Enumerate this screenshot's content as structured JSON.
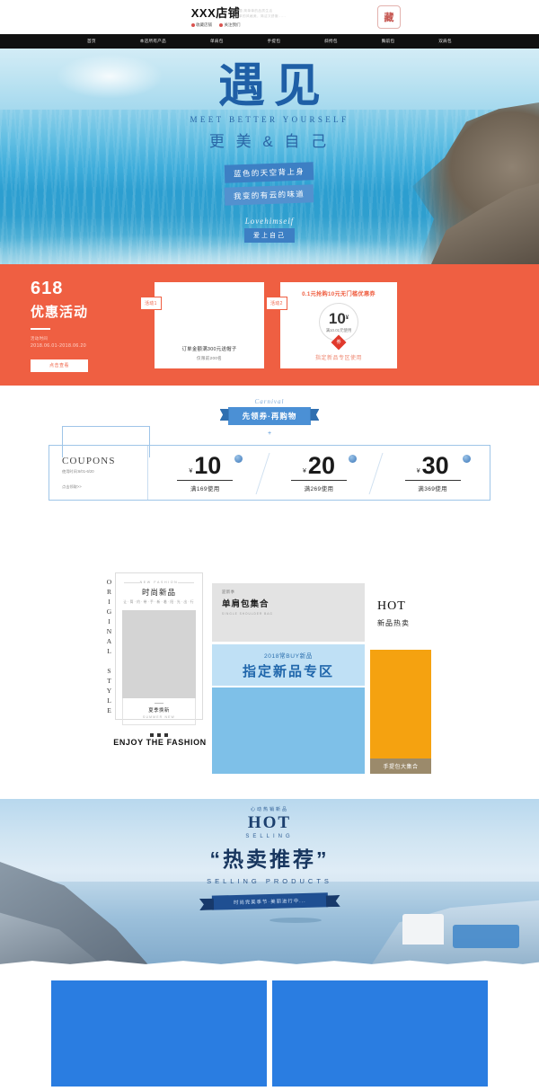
{
  "header": {
    "shop_name": "XXX店铺",
    "links": [
      {
        "label": "收藏店铺",
        "icon": "heart-icon"
      },
      {
        "label": "关注我们",
        "icon": "at-icon"
      }
    ],
    "slogan_line1": "主题  简单单的品质生活",
    "slogan_line2": "简单的风格美，简洁又舒服......",
    "seal_text": "藏"
  },
  "nav": {
    "items": [
      {
        "label": "首页"
      },
      {
        "label": "本店所有产品"
      },
      {
        "label": "单肩包"
      },
      {
        "label": "手提包"
      },
      {
        "label": "斜挎包"
      },
      {
        "label": "胸前包"
      },
      {
        "label": "双肩包"
      }
    ]
  },
  "hero": {
    "main_title": "遇见",
    "sub_en": "MEET BETTER YOURSELF",
    "sub_cn": "更 美 & 自 己",
    "tag1": "蓝色的天空背上身",
    "tag2": "我变的有云的味道",
    "script": "Lovehimself",
    "love_label": "爱上自己"
  },
  "promo618": {
    "number": "618",
    "title": "优惠活动",
    "time_label": "活动时间",
    "time_value": "2018.06.01-2018.06.20",
    "button": "点击查看",
    "card1": {
      "flag": "活动1",
      "line1": "订单金额满300元送帽子",
      "line2": "仅限前200名"
    },
    "card2": {
      "flag": "活动2",
      "title": "0.1元抢购10元无门槛优惠券",
      "coin_amount": "10",
      "coin_currency": "¥",
      "coin_condition": "满10.01元使用",
      "diamond_text": "券",
      "footer": "指定新品专区使用"
    }
  },
  "coupons": {
    "carnival": "Carnival",
    "ribbon": "先领券·再购物",
    "plus": "+",
    "panel_title": "COUPONS",
    "panel_valid": "使用时间:6/01-6/20",
    "panel_get": "点击领取>>",
    "items": [
      {
        "currency": "¥",
        "amount": "10",
        "condition": "满169使用"
      },
      {
        "currency": "¥",
        "amount": "20",
        "condition": "满269使用"
      },
      {
        "currency": "¥",
        "amount": "30",
        "condition": "满369使用"
      }
    ]
  },
  "showcase": {
    "vertical_text": "ORIGINAL STYLE",
    "new_card": {
      "en": "NEW FASHION",
      "cn": "时尚新品",
      "sub": "让·简·约·带·手·新·着·阳·光·出·行",
      "foot_cn": "夏季换新",
      "foot_en": "SUMMER NEW"
    },
    "enjoy": "ENJOY THE FASHION",
    "gray_panel": {
      "s1": "迎新季",
      "s2": "单肩包集合",
      "s3": "SINGLE SHOULDER BAG"
    },
    "hot_block": {
      "en": "HOT",
      "cn": "新品热卖"
    },
    "lightblue_panel": {
      "s1": "2018常BUY新品",
      "s2": "指定新品专区"
    },
    "orange_panel": {
      "footer": "手提包大集合"
    }
  },
  "hot_banner": {
    "arc": "心动热销新品",
    "hot": "HOT",
    "selling": "SELLING",
    "main": "“热卖推荐”",
    "products": "SELLING PRODUCTS",
    "ribbon": "时尚完美季节·美丽进行中..."
  },
  "bottom": {
    "tiles": [
      {
        "name": "product-tile-1"
      },
      {
        "name": "product-tile-2"
      }
    ]
  },
  "colors": {
    "orange": "#ef5f42",
    "blue": "#2a7de1",
    "light_blue": "#bfe0f5",
    "amber": "#f5a210",
    "nav_bg": "#101010"
  }
}
